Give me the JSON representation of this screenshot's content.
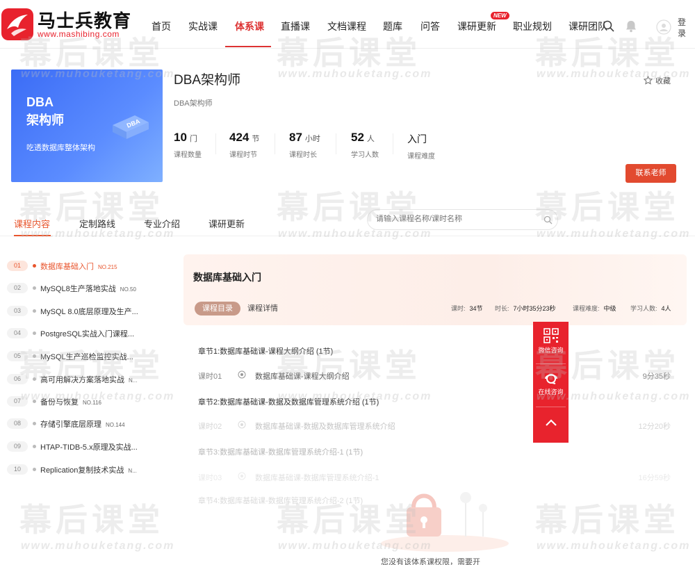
{
  "header": {
    "logo_title": "马士兵教育",
    "logo_url": "www.mashibing.com",
    "nav": [
      {
        "label": "首页"
      },
      {
        "label": "实战课"
      },
      {
        "label": "体系课"
      },
      {
        "label": "直播课"
      },
      {
        "label": "文档课程"
      },
      {
        "label": "题库"
      },
      {
        "label": "问答"
      },
      {
        "label": "课研更新",
        "badge": "NEW"
      },
      {
        "label": "职业规划"
      },
      {
        "label": "课研团队"
      }
    ],
    "login_label": "登录",
    "accent_color": "#d33"
  },
  "course": {
    "cover_title": "DBA\n架构师",
    "cover_title_l1": "DBA",
    "cover_title_l2": "架构师",
    "cover_box_label": "DBA",
    "cover_subtitle": "吃透数据库整体架构",
    "name": "DBA架构师",
    "subtitle": "DBA架构师",
    "stats": [
      {
        "value": "10",
        "unit": "门",
        "label": "课程数量"
      },
      {
        "value": "424",
        "unit": "节",
        "label": "课程时节"
      },
      {
        "value": "87",
        "unit": "小时",
        "label": "课程时长"
      },
      {
        "value": "52",
        "unit": "人",
        "label": "学习人数"
      },
      {
        "value": "入门",
        "unit": "",
        "label": "课程难度"
      }
    ],
    "favorite_label": "收藏",
    "contact_label": "联系老师"
  },
  "tabs": {
    "items": [
      "课程内容",
      "定制路线",
      "专业介绍",
      "课研更新"
    ],
    "search_placeholder": "请输入课程名称/课时名称"
  },
  "sidebar": {
    "items": [
      {
        "num": "01",
        "label": "数据库基础入门",
        "no": "NO.215"
      },
      {
        "num": "02",
        "label": "MySQL8生产落地实战",
        "no": "NO.50"
      },
      {
        "num": "03",
        "label": "MySQL 8.0底层原理及生产...",
        "no": ""
      },
      {
        "num": "04",
        "label": "PostgreSQL实战入门课程...",
        "no": ""
      },
      {
        "num": "05",
        "label": "MySQL生产巡检监控实战...",
        "no": ""
      },
      {
        "num": "06",
        "label": "高可用解决方案落地实战",
        "no": "N..."
      },
      {
        "num": "07",
        "label": "备份与恢复",
        "no": "NO.116"
      },
      {
        "num": "08",
        "label": "存储引擎底层原理",
        "no": "NO.144"
      },
      {
        "num": "09",
        "label": "HTAP-TIDB-5.x原理及实战...",
        "no": ""
      },
      {
        "num": "10",
        "label": "Replication复制技术实战",
        "no": "N..."
      }
    ]
  },
  "panel": {
    "title": "数据库基础入门",
    "subtabs": [
      "课程目录",
      "课程详情"
    ],
    "meta": [
      {
        "label": "课时:",
        "value": "34节"
      },
      {
        "label": "时长:",
        "value": "7小时35分23秒"
      },
      {
        "label": "课程难度:",
        "value": "中级"
      },
      {
        "label": "学习人数:",
        "value": "4人"
      }
    ],
    "chapters": [
      {
        "title": "章节1:数据库基础课-课程大纲介绍 (1节)",
        "lesson_no": "课时01",
        "lesson_name": "数据库基础课-课程大纲介绍",
        "duration": "9分35秒"
      },
      {
        "title": "章节2:数据库基础课-数据及数据库管理系统介绍 (1节)",
        "lesson_no": "课时02",
        "lesson_name": "数据库基础课-数据及数据库管理系统介绍",
        "duration": "12分20秒"
      },
      {
        "title": "章节3:数据库基础课-数据库管理系统介绍-1 (1节)",
        "lesson_no": "课时03",
        "lesson_name": "数据库基础课-数据库管理系统介绍-1",
        "duration": "16分59秒"
      },
      {
        "title": "章节4:数据库基础课-数据库管理系统介绍-2 (1节)",
        "lesson_no": "",
        "lesson_name": "",
        "duration": ""
      }
    ],
    "notice": "您没有该体系课权限，需要开"
  },
  "float": {
    "wechat_label": "微信咨询",
    "online_label": "在线咨询"
  },
  "watermark": {
    "text": "幕后课堂",
    "url": "www.muhouketang.com"
  }
}
